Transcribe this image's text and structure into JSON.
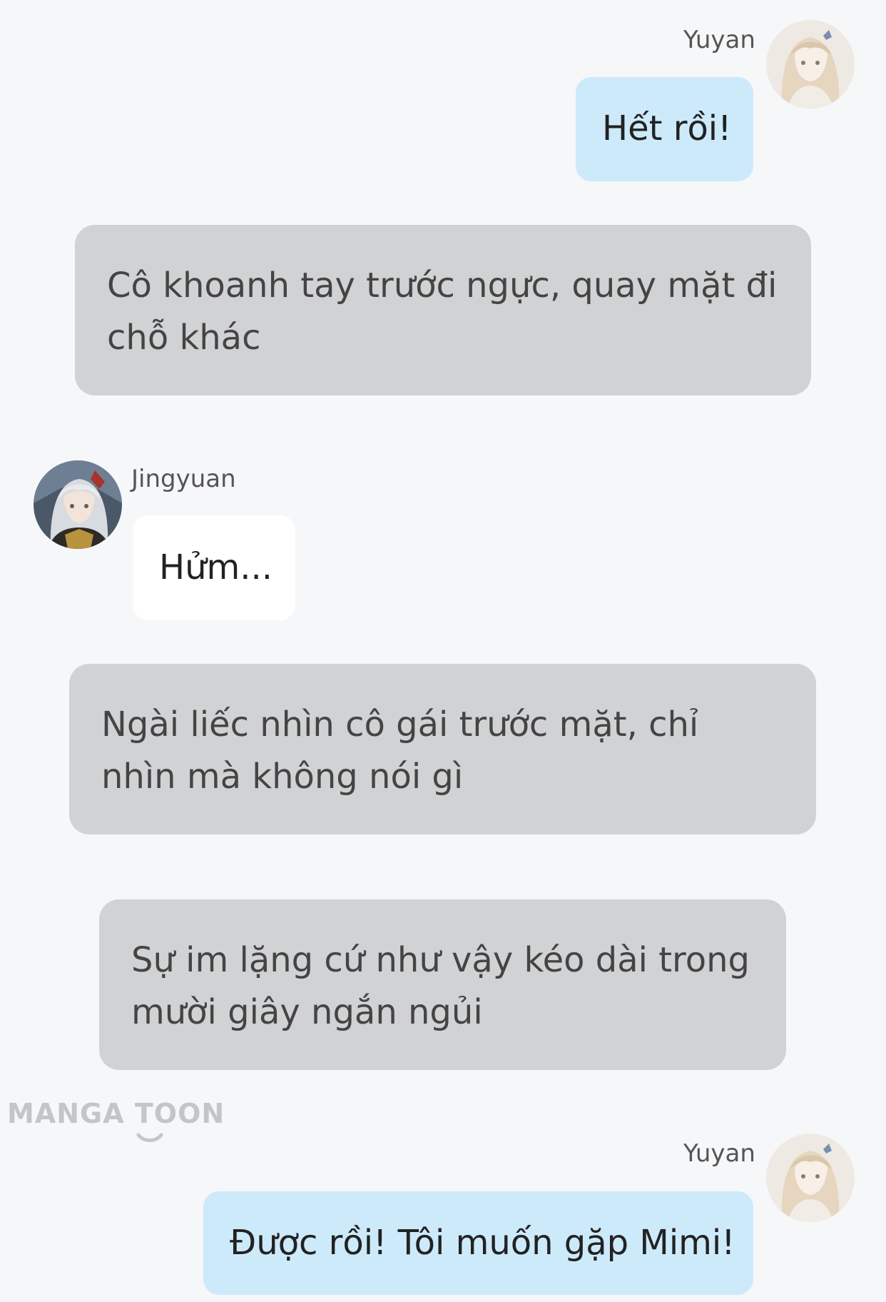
{
  "messages": [
    {
      "speaker": "Yuyan",
      "text": "Hết rồi!"
    },
    {
      "narration": "Cô khoanh tay trước ngực, quay mặt đi chỗ khác"
    },
    {
      "speaker": "Jingyuan",
      "text": "Hửm..."
    },
    {
      "narration": "Ngài liếc nhìn cô gái trước mặt, chỉ nhìn mà không nói gì"
    },
    {
      "narration": "Sự im lặng cứ như vậy kéo dài trong mười giây ngắn ngủi"
    },
    {
      "speaker": "Yuyan",
      "text": "Được rồi! Tôi muốn gặp Mimi!"
    }
  ],
  "watermark": {
    "text": "MANGA TOON"
  },
  "colors": {
    "background": "#f6f7f9",
    "self_bubble": "#cdeafb",
    "other_bubble": "#ffffff",
    "narration_box": "#d1d2d4"
  },
  "icons": {
    "yuyan_avatar": "yuyan-avatar",
    "jingyuan_avatar": "jingyuan-avatar",
    "watermark_logo": "mangatoon-logo"
  }
}
